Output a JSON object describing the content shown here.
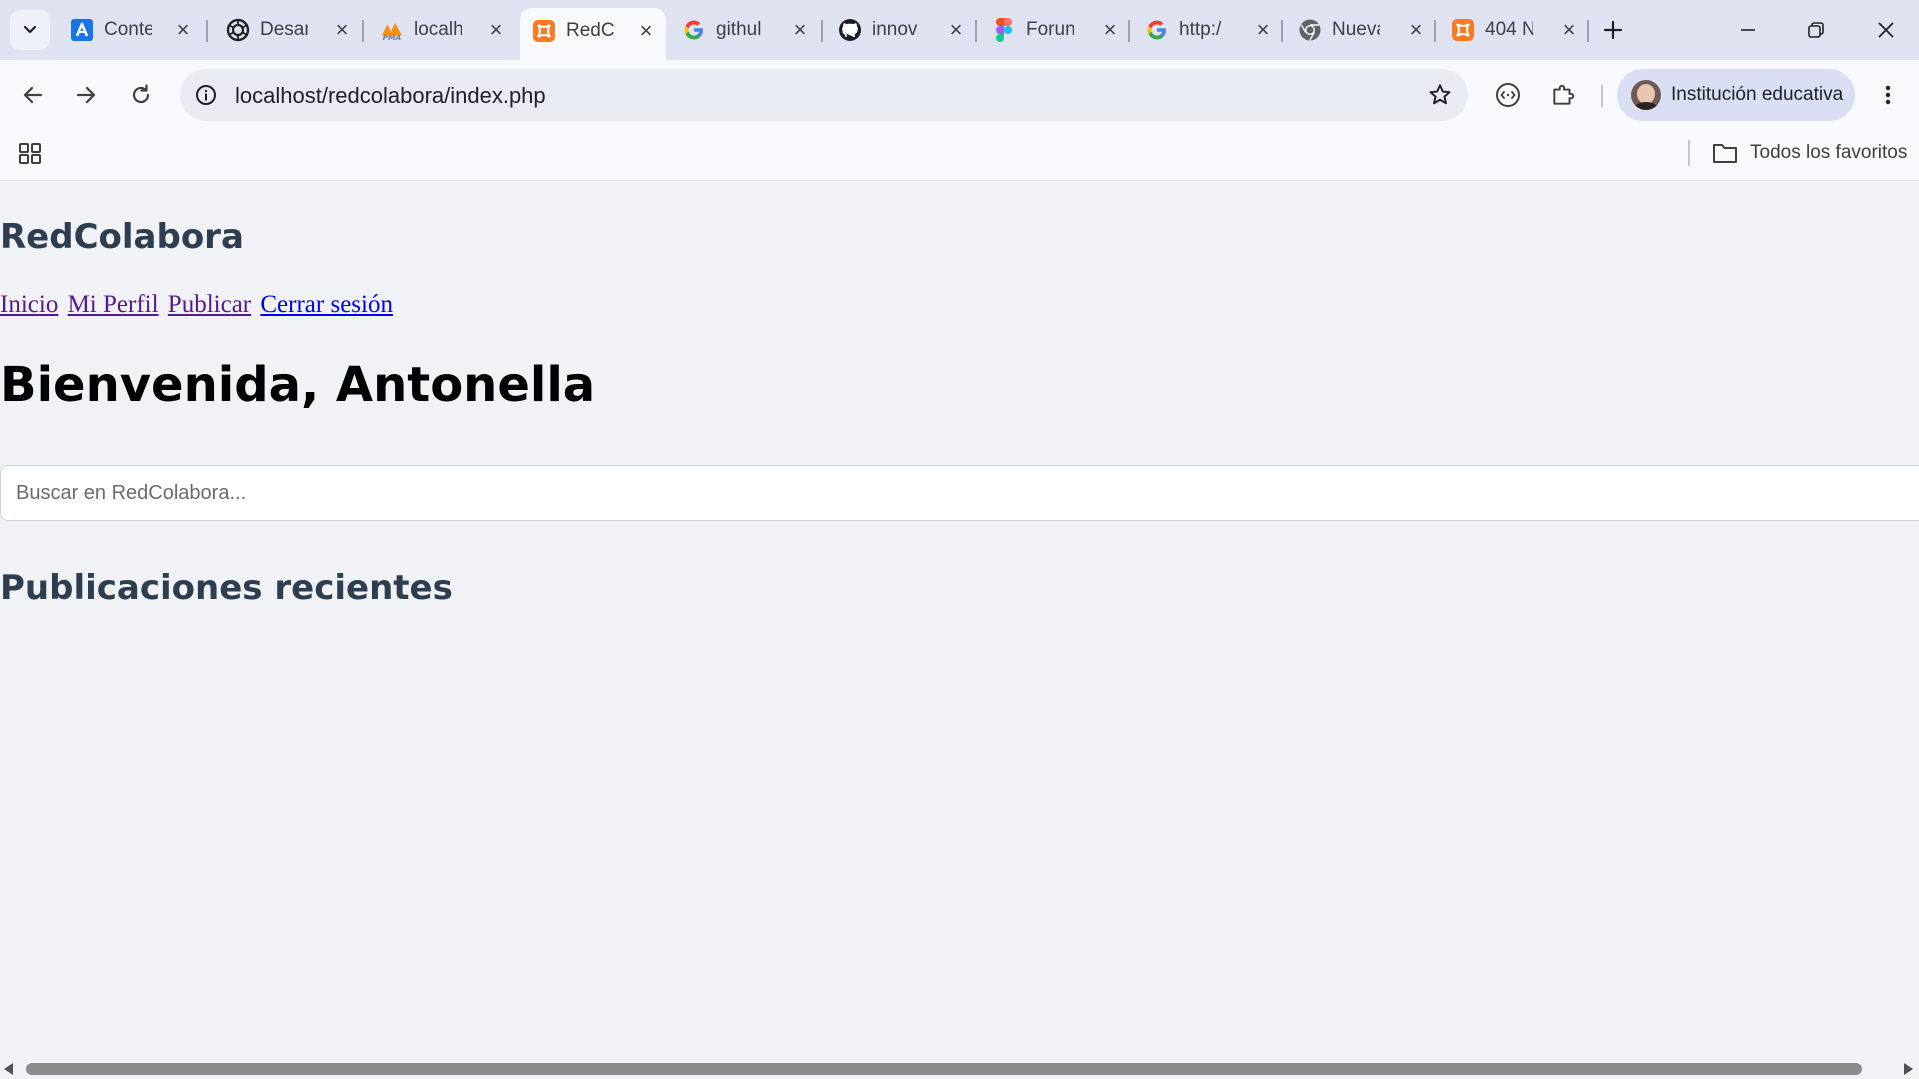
{
  "browser": {
    "tabs": [
      {
        "title": "Conte",
        "favicon": "google-ads-icon",
        "active": false
      },
      {
        "title": "Desar",
        "favicon": "openai-icon",
        "active": false
      },
      {
        "title": "localh",
        "favicon": "phpmyadmin-icon",
        "active": false
      },
      {
        "title": "RedCo",
        "favicon": "xampp-icon",
        "active": true
      },
      {
        "title": "githul",
        "favicon": "google-icon",
        "active": false
      },
      {
        "title": "innov",
        "favicon": "github-icon",
        "active": false
      },
      {
        "title": "Forun",
        "favicon": "figma-icon",
        "active": false
      },
      {
        "title": "http:/",
        "favicon": "google-icon",
        "active": false
      },
      {
        "title": "Nueva",
        "favicon": "chrome-icon",
        "active": false
      },
      {
        "title": "404 N",
        "favicon": "xampp-icon",
        "active": false
      }
    ],
    "address_bar": {
      "url": "localhost/redcolabora/index.php"
    },
    "profile": {
      "name": "Institución educativa"
    },
    "bookmarks": {
      "all_label": "Todos los favoritos"
    }
  },
  "page": {
    "site_title": "RedColabora",
    "nav": {
      "inicio": "Inicio",
      "perfil": "Mi Perfil",
      "publicar": "Publicar",
      "logout": "Cerrar sesión"
    },
    "welcome": "Bienvenida, Antonella",
    "search": {
      "placeholder": "Buscar en RedColabora...",
      "value": ""
    },
    "section_title": "Publicaciones recientes"
  },
  "colors": {
    "tabstrip_bg": "#dfe3f1",
    "toolbar_bg": "#f8f9fc",
    "page_bg": "#f0f2f5",
    "heading_color": "#2c3e50",
    "visited_link": "#551a8b",
    "unvisited_link": "#0000ee"
  }
}
